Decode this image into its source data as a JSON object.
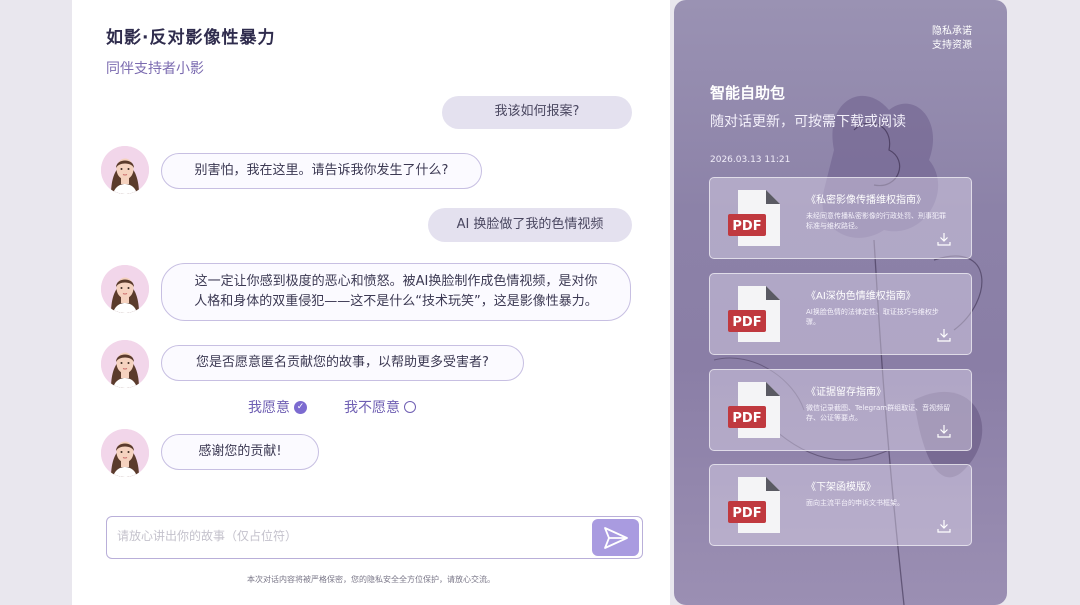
{
  "header": {
    "title": "如影·反对影像性暴力",
    "subtitle": "同伴支持者小影"
  },
  "chat": {
    "messages": [
      {
        "role": "user",
        "text": "我该如何报案?"
      },
      {
        "role": "bot",
        "text": "别害怕，我在这里。请告诉我你发生了什么?"
      },
      {
        "role": "user",
        "text": "AI 换脸做了我的色情视频"
      },
      {
        "role": "bot",
        "line1": "这一定让你感到极度的恶心和愤怒。被AI换脸制作成色情视频，是对你",
        "line2": "人格和身体的双重侵犯——这不是什么“技术玩笑”，这是影像性暴力。"
      },
      {
        "role": "bot",
        "text": "您是否愿意匿名贡献您的故事，以帮助更多受害者?"
      },
      {
        "role": "bot",
        "text": "感谢您的贡献!"
      }
    ],
    "choices": {
      "yes": "我愿意",
      "no": "我不愿意"
    }
  },
  "composer": {
    "placeholder": "请放心讲出你的故事（仅占位符）",
    "footnote": "本次对话内容将被严格保密，您的隐私安全全方位保护，请放心交流。"
  },
  "panel": {
    "links": [
      "隐私承诺",
      "支持资源"
    ],
    "title": "智能自助包",
    "subtitle": "随对话更新，可按需下载或阅读",
    "timestamp": "2026.03.13 11:21",
    "file_icon_label": "PDF",
    "cards": [
      {
        "title": "《私密影像传播维权指南》",
        "desc": "未经同意传播私密影像的行政处罚、刑事犯罪标准与维权路径。"
      },
      {
        "title": "《AI深伪色情维权指南》",
        "desc": "AI换脸色情的法律定性、取证技巧与维权步骤。"
      },
      {
        "title": "《证据留存指南》",
        "desc": "微信记录截图、Telegram群组取证、音视频留存、公证等要点。"
      },
      {
        "title": "《下架函模版》",
        "desc": "面向主流平台的申诉文书框架。"
      }
    ]
  },
  "colors": {
    "accent": "#7c6bd0",
    "panel_bg": "#8c82a8",
    "pdf_red": "#c0393f"
  }
}
